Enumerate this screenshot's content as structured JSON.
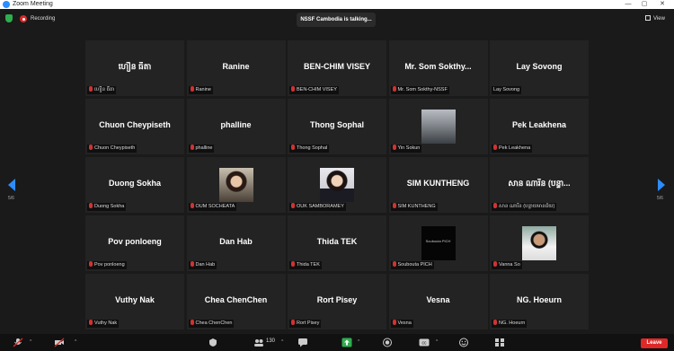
{
  "window": {
    "title": "Zoom Meeting"
  },
  "topbar": {
    "recording_label": "Recording",
    "talking_text": "NSSF Cambodia is talking...",
    "view_label": "View"
  },
  "navigation": {
    "page_left": "5/6",
    "page_right": "5/6"
  },
  "participants": [
    {
      "display": "ហឿន ធីតា",
      "label": "ហឿន ធីតា"
    },
    {
      "display": "Ranine",
      "label": "Ranine"
    },
    {
      "display": "BEN-CHIM VISEY",
      "label": "BEN-CHIM VISEY"
    },
    {
      "display": "Mr. Som Sokthy...",
      "label": "Mr. Som Sokthy-NSSF"
    },
    {
      "display": "Lay Sovong",
      "label": "Lay Sovong"
    },
    {
      "display": "Chuon Cheypiseth",
      "label": "Chuon Cheypiseth"
    },
    {
      "display": "phalline",
      "label": "phalline"
    },
    {
      "display": "Thong Sophal",
      "label": "Thong Sophal"
    },
    {
      "display": "",
      "label": "Yin Sokun"
    },
    {
      "display": "Pek Leakhena",
      "label": "Pek Leakhena"
    },
    {
      "display": "Duong Sokha",
      "label": "Duong Sokha"
    },
    {
      "display": "",
      "label": "OUM SOCHEATA"
    },
    {
      "display": "",
      "label": "OUK SAMBORAMEY"
    },
    {
      "display": "SIM KUNTHENG",
      "label": "SIM KUNTHENG"
    },
    {
      "display": "សាន ណារីន (បន្ទា...",
      "label": "សាន ណារីន (បន្ទាយមានជ័យ)"
    },
    {
      "display": "Pov ponloeng",
      "label": "Pov ponloeng"
    },
    {
      "display": "Dan Hab",
      "label": "Dan Hab"
    },
    {
      "display": "Thida TEK",
      "label": "Thida TEK"
    },
    {
      "display": "",
      "label": "Soubouta PICH",
      "thumb_text": "Soubouta PICH"
    },
    {
      "display": "",
      "label": "Vanna So"
    },
    {
      "display": "Vuthy Nak",
      "label": "Vuthy Nak"
    },
    {
      "display": "Chea ChenChen",
      "label": "Chea ChenChen"
    },
    {
      "display": "Rort Pisey",
      "label": "Rort Pisey"
    },
    {
      "display": "Vesna",
      "label": "Vesna"
    },
    {
      "display": "NG. Hoeurn",
      "label": "NG. Hoeurn"
    }
  ],
  "toolbar": {
    "participant_count": "130",
    "leave_label": "Leave"
  },
  "colors": {
    "accent": "#2d8cff",
    "leave": "#e02828",
    "share": "#2eae4f"
  }
}
